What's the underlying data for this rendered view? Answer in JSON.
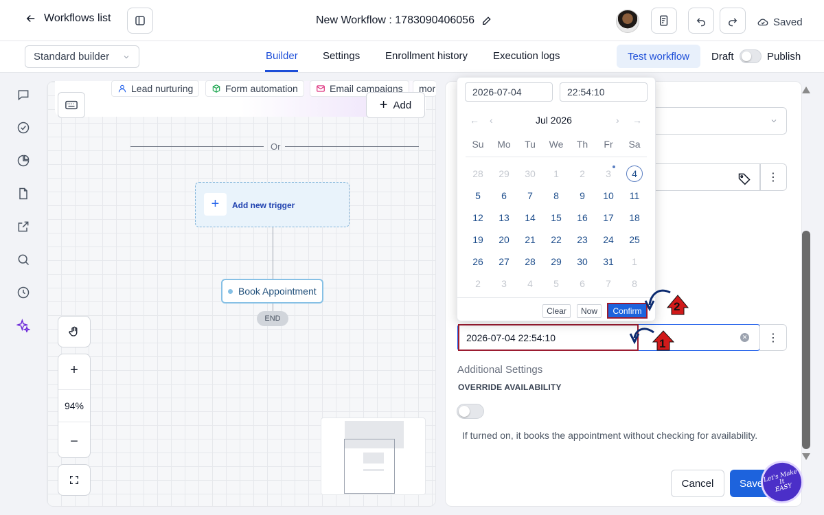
{
  "header": {
    "back_label": "Workflows list",
    "workflow_title": "New Workflow : 1783090406056",
    "saved_label": "Saved"
  },
  "subnav": {
    "builder_select": "Standard builder",
    "tabs": [
      "Builder",
      "Settings",
      "Enrollment history",
      "Execution logs"
    ],
    "active_tab": "Builder",
    "test_button": "Test workflow",
    "draft_label": "Draft",
    "publish_label": "Publish"
  },
  "canvas": {
    "chips": [
      "Lead nurturing",
      "Form automation",
      "Email campaigns",
      "mor"
    ],
    "add_button": "Add",
    "or_label": "Or",
    "trigger_label": "Add new trigger",
    "action_node": "Book Appointment",
    "end_label": "END",
    "zoom_level": "94%",
    "zoom_in": "+",
    "zoom_out": "−"
  },
  "datepicker": {
    "date_input": "2026-07-04",
    "time_input": "22:54:10",
    "month_label": "Jul 2026",
    "weekdays": [
      "Su",
      "Mo",
      "Tu",
      "We",
      "Th",
      "Fr",
      "Sa"
    ],
    "weeks": [
      [
        "28",
        "29",
        "30",
        "1",
        "2",
        "3",
        "4"
      ],
      [
        "5",
        "6",
        "7",
        "8",
        "9",
        "10",
        "11"
      ],
      [
        "12",
        "13",
        "14",
        "15",
        "16",
        "17",
        "18"
      ],
      [
        "19",
        "20",
        "21",
        "22",
        "23",
        "24",
        "25"
      ],
      [
        "26",
        "27",
        "28",
        "29",
        "30",
        "31",
        "1"
      ],
      [
        "2",
        "3",
        "4",
        "5",
        "6",
        "7",
        "8"
      ]
    ],
    "selected_day": "4",
    "clear_label": "Clear",
    "now_label": "Now",
    "confirm_label": "Confirm"
  },
  "panel": {
    "datetime_value": "2026-07-04 22:54:10",
    "additional_settings": "Additional Settings",
    "override_label": "OVERRIDE AVAILABILITY",
    "override_help": "If turned on, it books the appointment without checking for availability.",
    "cancel_label": "Cancel",
    "save_label": "Save"
  },
  "annotations": {
    "step1": "1",
    "step2": "2",
    "logo_text": "Let's Make It EASY"
  },
  "colors": {
    "accent": "#1d63dd",
    "highlight_box": "#9b1b30",
    "annotation_arrow": "#d11a1a"
  }
}
